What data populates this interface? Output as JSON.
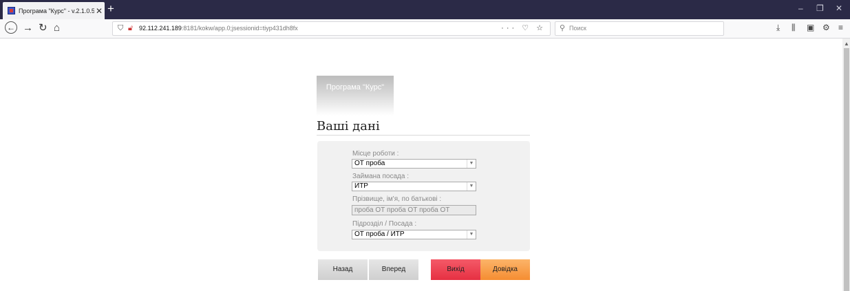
{
  "browser": {
    "tab_title": "Програма \"Курс\" - v.2.1.0.5-rc",
    "tab_close": "✕",
    "new_tab": "+",
    "url_host": "92.112.241.189",
    "url_rest": ":8181/kokw/app.0;jsessionid=tiyp431dh8fx",
    "url_actions": "··· ♡ ☆",
    "search_placeholder": "Поиск",
    "window_controls": {
      "minimize": "–",
      "maximize": "❐",
      "close": "✕"
    }
  },
  "app": {
    "logo_text": "Програма \"Курс\"",
    "heading": "Ваші дані",
    "fields": {
      "workplace_label": "Місце роботи :",
      "workplace_value": "ОТ проба",
      "position_label": "Займана посада :",
      "position_value": "ИТР",
      "fullname_label": "Прізвище, ім'я, по батькові :",
      "fullname_value": "проба ОТ проба ОТ проба ОТ",
      "division_label": "Підрозділ / Посада :",
      "division_value": "ОТ проба / ИТР"
    },
    "buttons": {
      "back": "Назад",
      "next": "Вперед",
      "exit": "Вихід",
      "help": "Довідка"
    }
  }
}
